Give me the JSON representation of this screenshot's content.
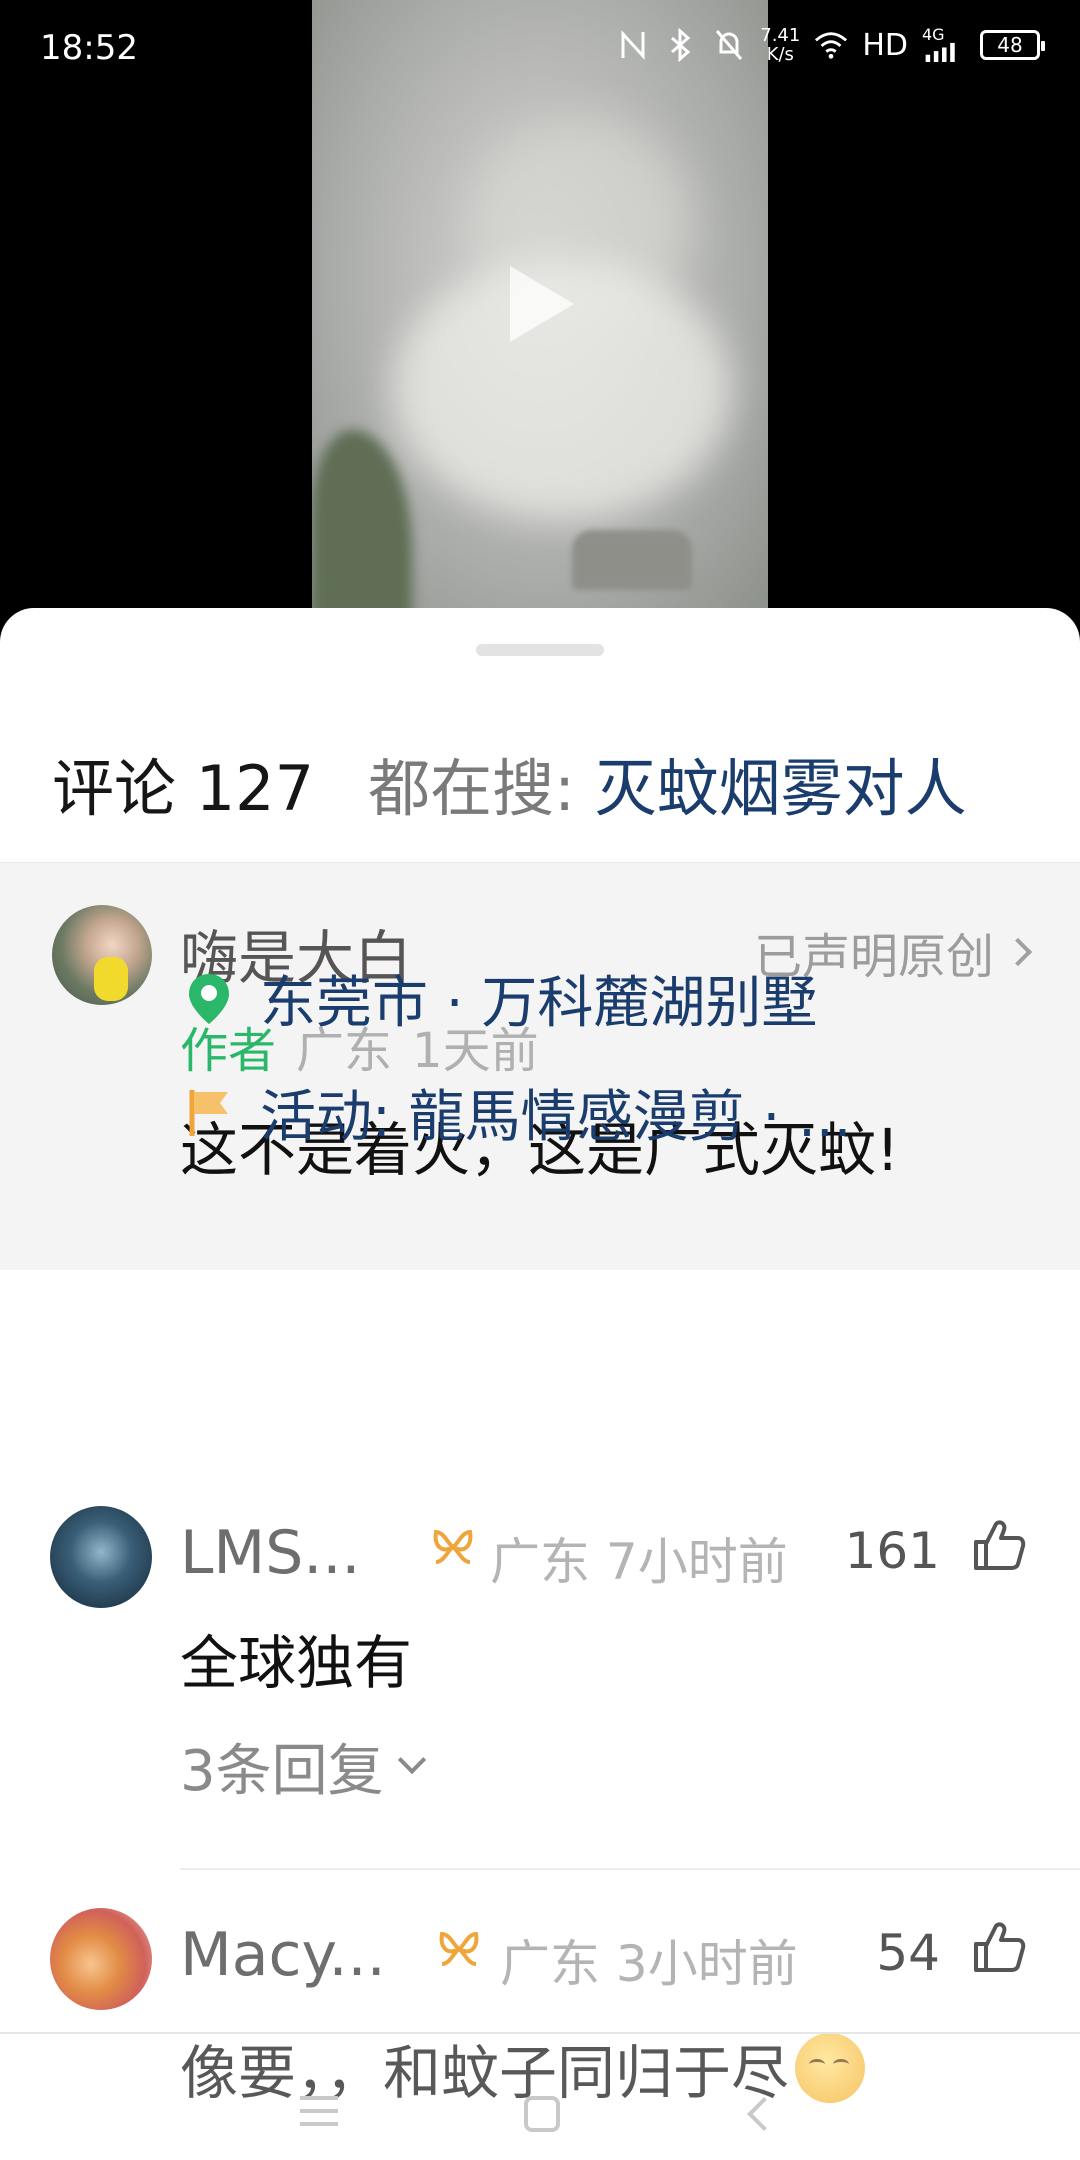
{
  "status_bar": {
    "time": "18:52",
    "net_speed_value": "7.41",
    "net_speed_unit": "K/s",
    "hd_label": "HD",
    "signal_label": "4G",
    "battery": "48",
    "icons": [
      "nfc-icon",
      "bluetooth-icon",
      "mute-bell-icon",
      "wifi-icon",
      "signal-icon",
      "battery-icon"
    ]
  },
  "video": {
    "play_icon": "play-icon"
  },
  "comments": {
    "title": "评论 127",
    "search_prefix": "都在搜:",
    "search_term": "灭蚊烟雾对人"
  },
  "author_post": {
    "name": "嗨是大白",
    "original_label": "已声明原创",
    "tag": "作者",
    "location": "广东",
    "time": "1天前",
    "text": "这不是着火，这是广式灭蚊!",
    "place": "东莞市 · 万科麓湖别墅",
    "activity": "活动: 龍馬情感漫剪 · ...",
    "place_icon": "location-pin-icon",
    "activity_icon": "flag-icon"
  },
  "comment_list": [
    {
      "name": "LMS...",
      "location": "广东",
      "time": "7小时前",
      "likes": "161",
      "text": "全球独有",
      "replies": "3条回复"
    },
    {
      "name": "Macy...",
      "location": "广东",
      "time": "3小时前",
      "likes": "54",
      "text": "像要，，和蚊子同归于尽"
    }
  ],
  "colors": {
    "link": "#1a3d6e",
    "author_tag": "#2bb769",
    "badge": "#f0a53a"
  }
}
